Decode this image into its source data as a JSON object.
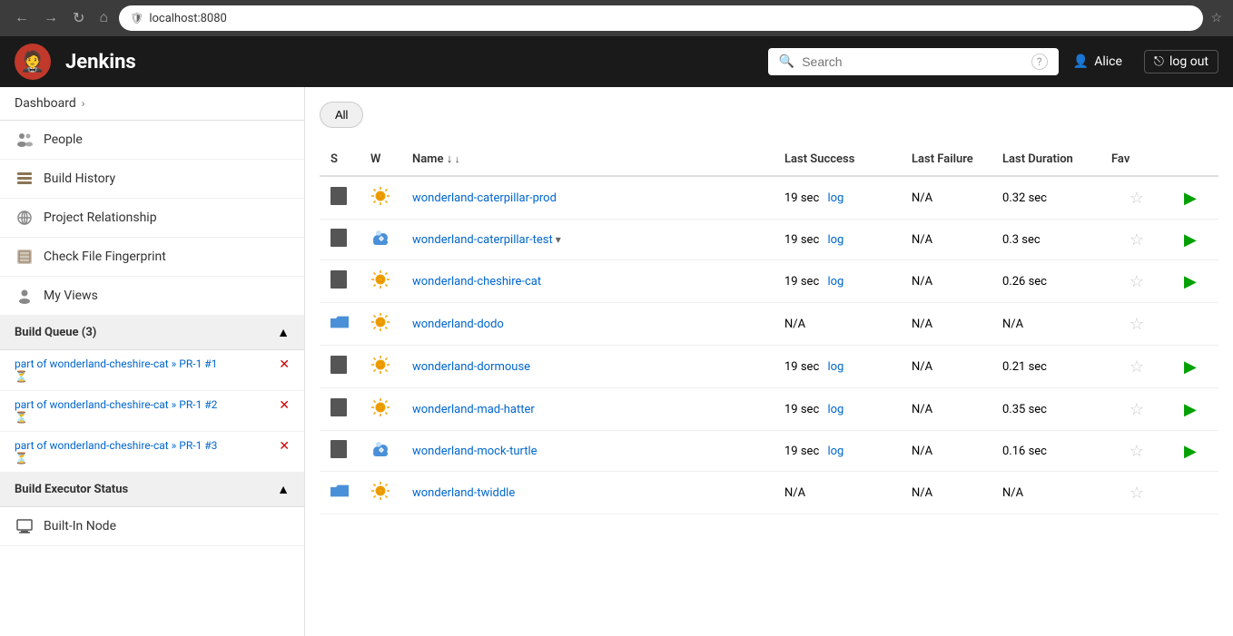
{
  "browser": {
    "url": "localhost:8080",
    "back": "←",
    "forward": "→",
    "refresh": "↻",
    "home": "⌂"
  },
  "header": {
    "title": "Jenkins",
    "logo": "🤵",
    "search_placeholder": "Search",
    "help": "?",
    "user_icon": "👤",
    "user_name": "Alice",
    "logout_label": "log out",
    "logout_icon": "⎋"
  },
  "breadcrumb": {
    "label": "Dashboard",
    "chevron": "›"
  },
  "sidebar": {
    "nav_items": [
      {
        "id": "people",
        "icon": "👥",
        "label": "People"
      },
      {
        "id": "build-history",
        "icon": "📋",
        "label": "Build History"
      },
      {
        "id": "project-relationship",
        "icon": "🔍",
        "label": "Project Relationship"
      },
      {
        "id": "check-fingerprint",
        "icon": "🖼",
        "label": "Check File Fingerprint"
      },
      {
        "id": "my-views",
        "icon": "👤",
        "label": "My Views"
      }
    ],
    "build_queue": {
      "title": "Build Queue (3)",
      "collapse_icon": "▲",
      "items": [
        {
          "label": "part of wonderland-cheshire-cat » PR-1 #1"
        },
        {
          "label": "part of wonderland-cheshire-cat » PR-1 #2"
        },
        {
          "label": "part of wonderland-cheshire-cat » PR-1 #3"
        }
      ]
    },
    "build_executor": {
      "title": "Build Executor Status",
      "collapse_icon": "▲",
      "node": "Built-In Node"
    }
  },
  "main": {
    "all_label": "All",
    "table": {
      "columns": [
        {
          "id": "s",
          "label": "S"
        },
        {
          "id": "w",
          "label": "W"
        },
        {
          "id": "name",
          "label": "Name",
          "sortable": true
        },
        {
          "id": "last_success",
          "label": "Last Success"
        },
        {
          "id": "last_failure",
          "label": "Last Failure"
        },
        {
          "id": "last_duration",
          "label": "Last Duration"
        },
        {
          "id": "fav",
          "label": "Fav"
        }
      ],
      "rows": [
        {
          "id": "row-1",
          "status_icon": "book",
          "weather": "☀",
          "weather_extra": "⚙",
          "name": "wonderland-caterpillar-prod",
          "last_success": "19 sec",
          "log": "log",
          "last_failure": "N/A",
          "last_duration": "0.32 sec",
          "fav": false,
          "folder": false
        },
        {
          "id": "row-2",
          "status_icon": "book",
          "weather": "☁",
          "weather_extra": "⬇",
          "name": "wonderland-caterpillar-test",
          "name_extra": "▾",
          "last_success": "19 sec",
          "log": "log",
          "last_failure": "N/A",
          "last_duration": "0.3 sec",
          "fav": false,
          "folder": false
        },
        {
          "id": "row-3",
          "status_icon": "book",
          "weather": "☀",
          "weather_extra": "⚙",
          "name": "wonderland-cheshire-cat",
          "last_success": "19 sec",
          "log": "log",
          "last_failure": "N/A",
          "last_duration": "0.26 sec",
          "fav": false,
          "folder": false
        },
        {
          "id": "row-4",
          "status_icon": "folder",
          "weather": "☀",
          "weather_extra": "⚙",
          "name": "wonderland-dodo",
          "last_success": "N/A",
          "log": "",
          "last_failure": "N/A",
          "last_duration": "N/A",
          "fav": false,
          "folder": true
        },
        {
          "id": "row-5",
          "status_icon": "book",
          "weather": "☀",
          "weather_extra": "⚙",
          "name": "wonderland-dormouse",
          "last_success": "19 sec",
          "log": "log",
          "last_failure": "N/A",
          "last_duration": "0.21 sec",
          "fav": false,
          "folder": false
        },
        {
          "id": "row-6",
          "status_icon": "book",
          "weather": "☀",
          "weather_extra": "⚙",
          "name": "wonderland-mad-hatter",
          "last_success": "19 sec",
          "log": "log",
          "last_failure": "N/A",
          "last_duration": "0.35 sec",
          "fav": false,
          "folder": false
        },
        {
          "id": "row-7",
          "status_icon": "book",
          "weather": "☁",
          "weather_extra": "⬇",
          "name": "wonderland-mock-turtle",
          "last_success": "19 sec",
          "log": "log",
          "last_failure": "N/A",
          "last_duration": "0.16 sec",
          "fav": false,
          "folder": false
        },
        {
          "id": "row-8",
          "status_icon": "folder",
          "weather": "☀",
          "weather_extra": "⚙",
          "name": "wonderland-twiddle",
          "last_success": "N/A",
          "log": "",
          "last_failure": "N/A",
          "last_duration": "N/A",
          "fav": false,
          "folder": true
        }
      ]
    }
  }
}
